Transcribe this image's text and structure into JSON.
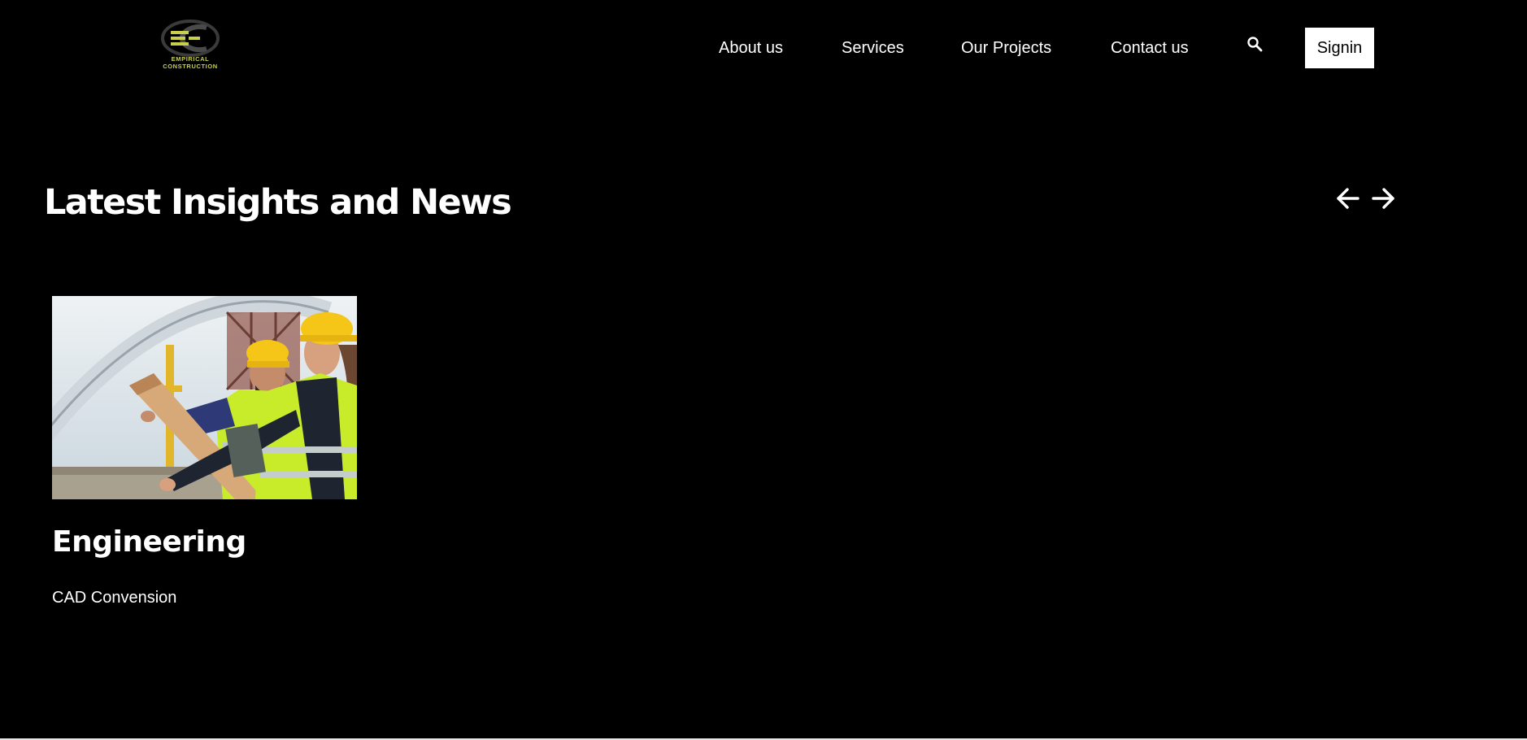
{
  "header": {
    "logo_text": "EMPIRICAL CONSTRUCTION",
    "nav_items": [
      "About us",
      "Services",
      "Our Projects",
      "Contact us"
    ],
    "search_icon": "search-icon",
    "signin_label": "Signin"
  },
  "insights": {
    "title": "Latest Insights and News",
    "prev_icon": "arrow-left-icon",
    "next_icon": "arrow-right-icon",
    "cards": [
      {
        "category": "Engineering",
        "title": "CAD Convension",
        "image": "engineers-reviewing-blueprint-photo"
      }
    ]
  },
  "colors": {
    "background": "#000000",
    "text": "#ffffff",
    "button_bg": "#ffffff",
    "button_text": "#000000",
    "logo_accent": "#c9cf4a",
    "safety_vest": "#c8ec2a",
    "hard_hat": "#f5c518"
  }
}
